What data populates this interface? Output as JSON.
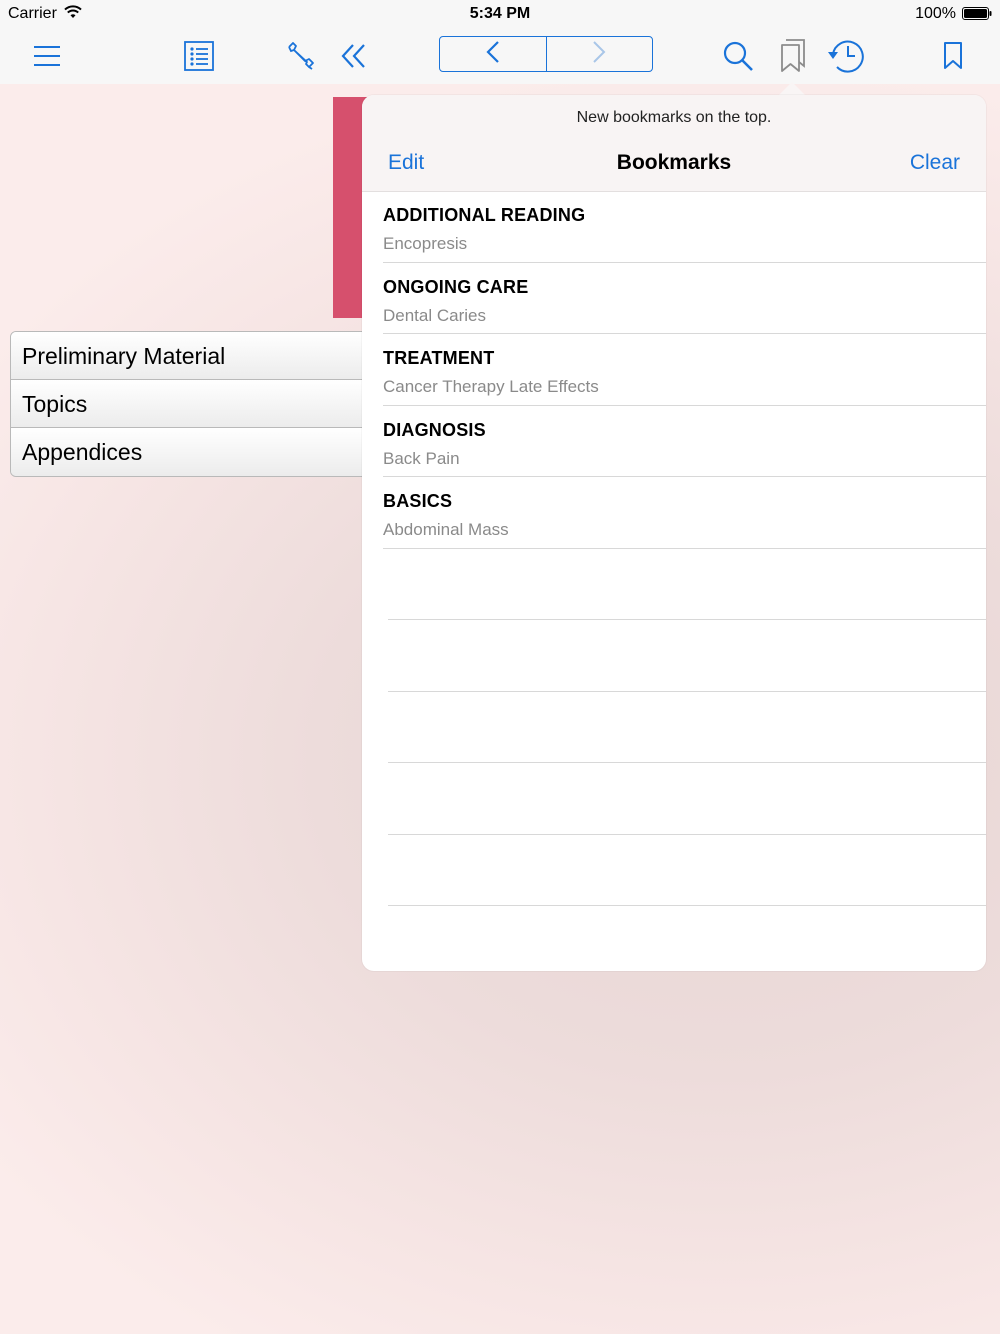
{
  "status_bar": {
    "carrier": "Carrier",
    "time": "5:34 PM",
    "battery": "100%"
  },
  "toolbar": {
    "icons": [
      "menu-icon",
      "list-icon",
      "wrench-icon",
      "double-chevron-left-icon",
      "chevron-left-icon",
      "chevron-right-icon",
      "search-icon",
      "bookmarks-icon",
      "history-icon",
      "bookmark-icon"
    ],
    "accent_color": "#1a73d9"
  },
  "menu": {
    "items": [
      {
        "label": "Preliminary Material"
      },
      {
        "label": "Topics"
      },
      {
        "label": "Appendices"
      }
    ]
  },
  "popover": {
    "note": "New bookmarks on the top.",
    "edit_label": "Edit",
    "title": "Bookmarks",
    "clear_label": "Clear",
    "bookmarks": [
      {
        "title": "ADDITIONAL READING",
        "subtitle": "Encopresis"
      },
      {
        "title": "ONGOING CARE",
        "subtitle": "Dental Caries"
      },
      {
        "title": "TREATMENT",
        "subtitle": "Cancer Therapy Late Effects"
      },
      {
        "title": "DIAGNOSIS",
        "subtitle": "Back Pain"
      },
      {
        "title": "BASICS",
        "subtitle": "Abdominal Mass"
      }
    ]
  }
}
